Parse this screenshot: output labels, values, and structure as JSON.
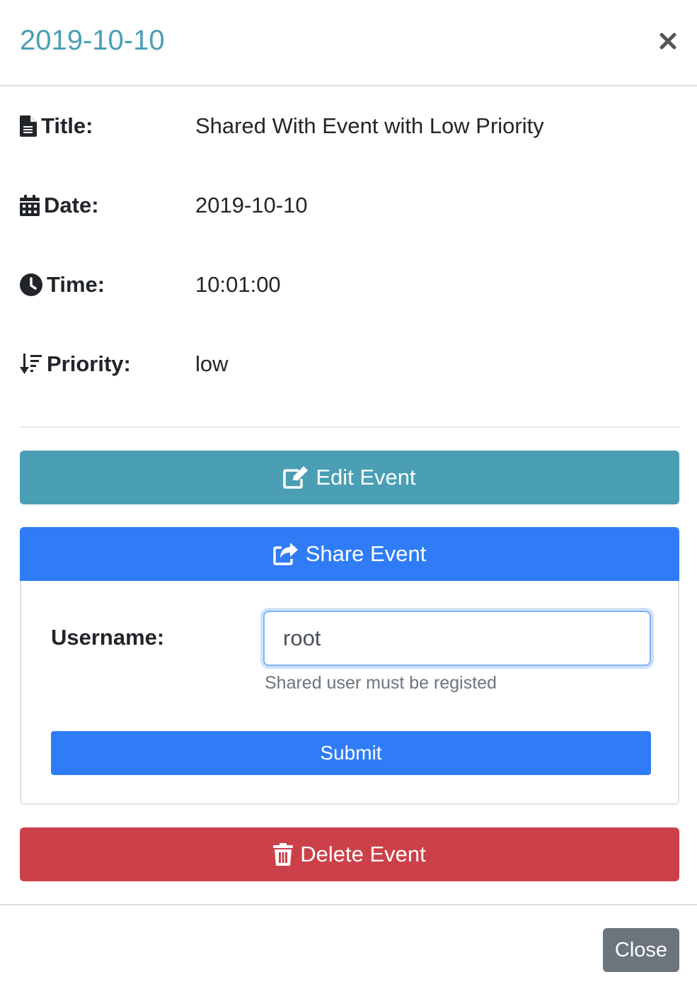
{
  "modal": {
    "title": "2019-10-10",
    "close_icon": "close-icon"
  },
  "details": {
    "title_label": "Title:",
    "title_value": "Shared With Event with Low Priority",
    "date_label": "Date:",
    "date_value": "2019-10-10",
    "time_label": "Time:",
    "time_value": "10:01:00",
    "priority_label": "Priority:",
    "priority_value": "low"
  },
  "actions": {
    "edit_label": "Edit Event",
    "share_label": "Share Event",
    "delete_label": "Delete Event"
  },
  "share_form": {
    "username_label": "Username:",
    "username_value": "root",
    "help_text": "Shared user must be registed",
    "submit_label": "Submit"
  },
  "footer": {
    "close_label": "Close"
  },
  "colors": {
    "title": "#4a9fb5",
    "edit": "#4a9fb5",
    "share": "#2f7cf6",
    "delete": "#cc4149",
    "close": "#6c757d"
  }
}
